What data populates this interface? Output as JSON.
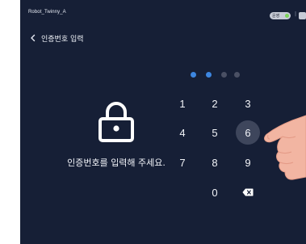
{
  "status_bar": {
    "device_name": "Robot_Twinny_A",
    "status_label": "운영",
    "separator": "|"
  },
  "header": {
    "back_icon": "chevron-left-icon",
    "title": "인증번호 입력"
  },
  "lock": {
    "icon": "lock-icon",
    "instruction": "인증번호를 입력해 주세요."
  },
  "pin": {
    "entered": 2,
    "length": 4,
    "filled_color": "#3d86e0",
    "empty_color": "#4a5064"
  },
  "keypad": {
    "keys": [
      "1",
      "2",
      "3",
      "4",
      "5",
      "6",
      "7",
      "8",
      "9",
      "0"
    ],
    "pressed_key": "6",
    "backspace_icon": "backspace-icon"
  },
  "colors": {
    "screen_background": "#161f36",
    "key_pressed_background": "#3e465c",
    "status_pill_dot": "#7bd35a"
  }
}
